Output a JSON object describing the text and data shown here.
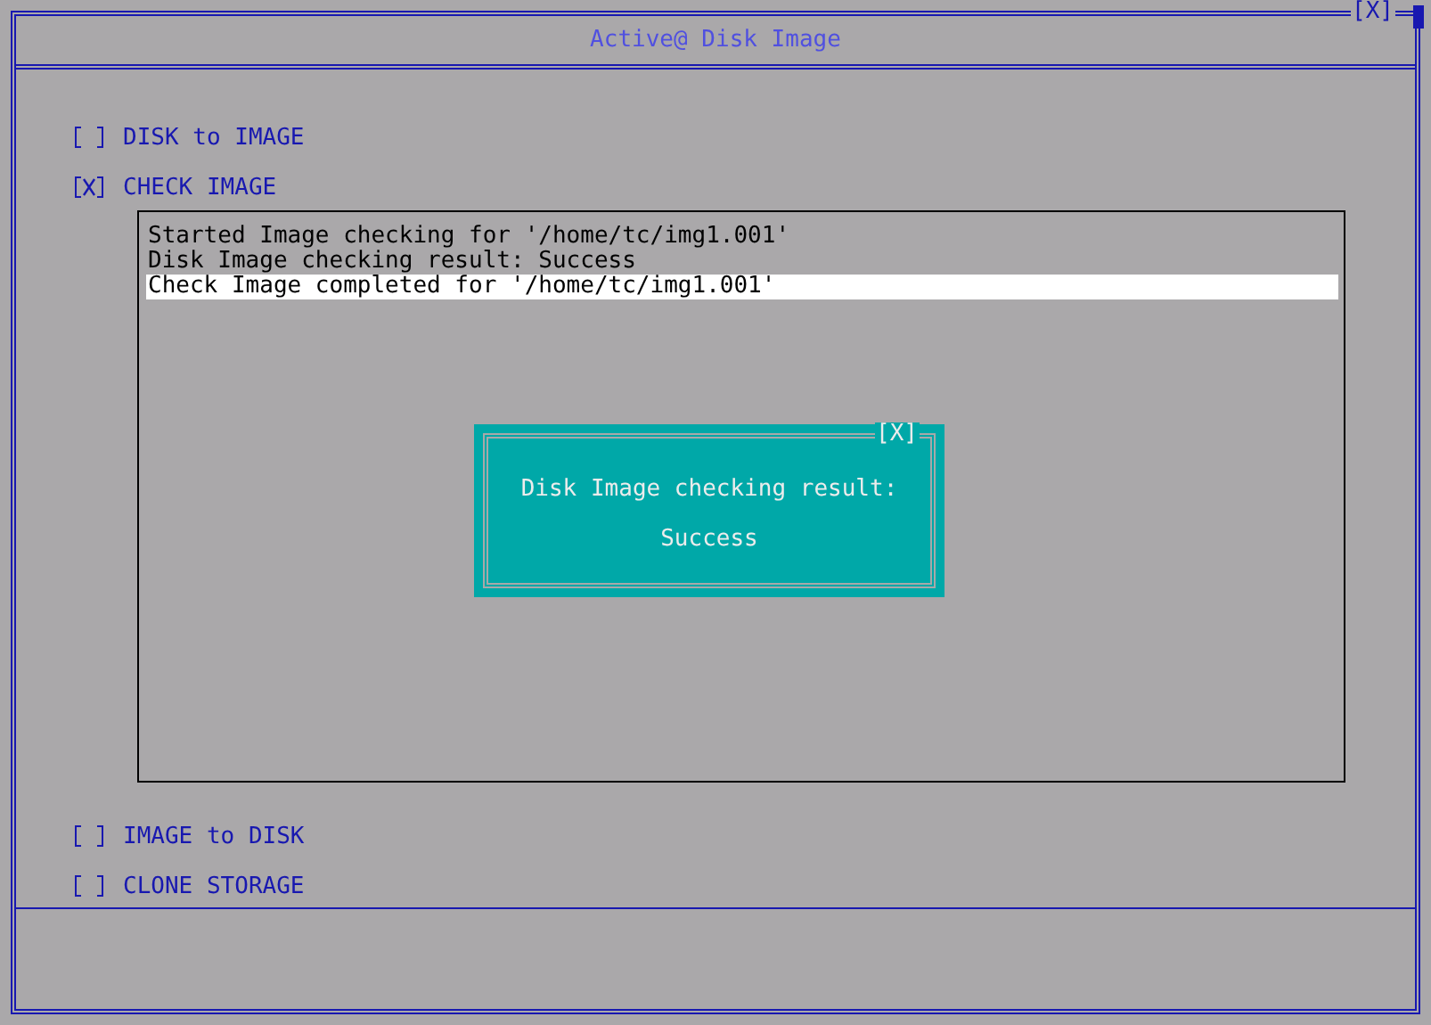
{
  "window": {
    "title": "Active@ Disk Image",
    "close_label": "[X]"
  },
  "options_top": [
    {
      "label": "DISK to IMAGE",
      "checked": false
    },
    {
      "label": "CHECK IMAGE",
      "checked": true
    }
  ],
  "log": [
    {
      "text": "Started Image checking for '/home/tc/img1.001'",
      "selected": false
    },
    {
      "text": "Disk Image checking result: Success",
      "selected": false
    },
    {
      "text": "Check Image completed for '/home/tc/img1.001'",
      "selected": true
    }
  ],
  "dialog": {
    "close_label": "[X]",
    "message": "Disk Image checking result:",
    "result": "Success"
  },
  "options_bottom": [
    {
      "label": "IMAGE to DISK",
      "checked": false
    },
    {
      "label": "CLONE STORAGE",
      "checked": false
    }
  ]
}
